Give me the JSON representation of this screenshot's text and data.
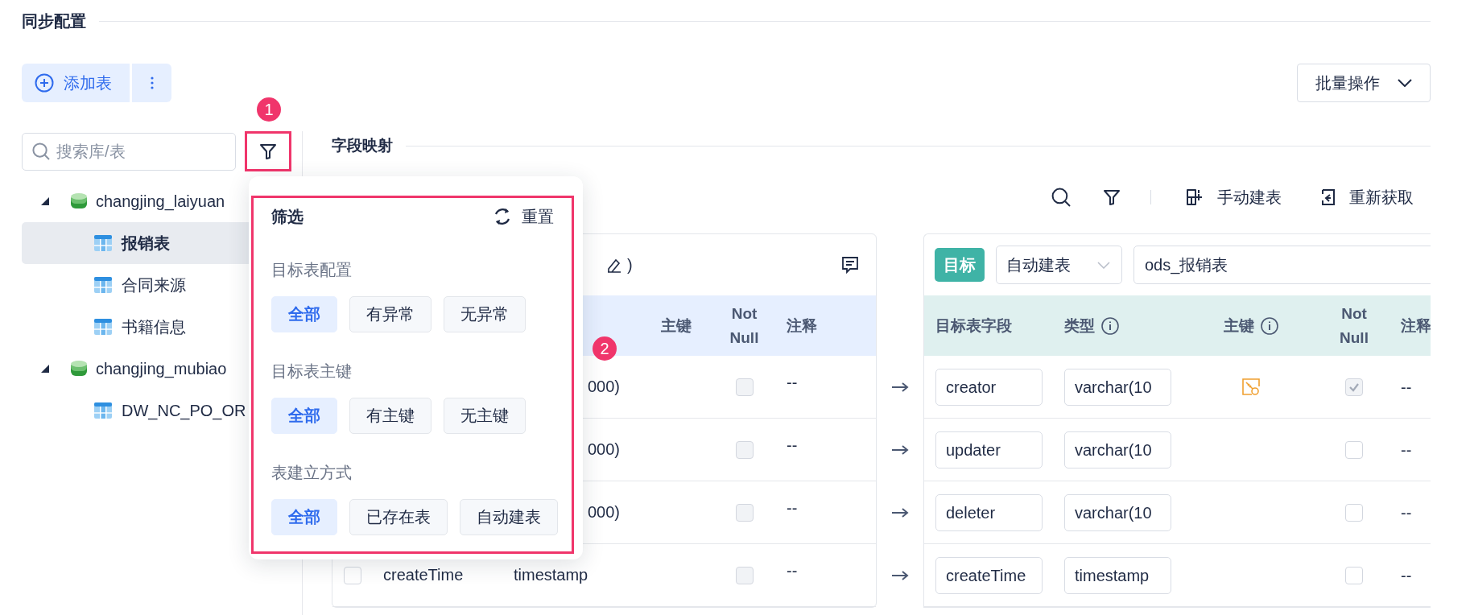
{
  "page_title": "同步配置",
  "add_button": {
    "label": "添加表"
  },
  "batch_button": {
    "label": "批量操作"
  },
  "search": {
    "placeholder": "搜索库/表"
  },
  "tree": [
    {
      "label": "changjing_laiyuan",
      "expanded": true,
      "children": [
        {
          "label": "报销表",
          "selected": true
        },
        {
          "label": "合同来源",
          "selected": false
        },
        {
          "label": "书籍信息",
          "selected": false
        }
      ]
    },
    {
      "label": "changjing_mubiao",
      "expanded": true,
      "children": [
        {
          "label": "DW_NC_PO_OR",
          "selected": false
        }
      ]
    }
  ],
  "annotations": [
    {
      "label": "1"
    },
    {
      "label": "2"
    }
  ],
  "filter_popover": {
    "title": "筛选",
    "reset": "重置",
    "groups": [
      {
        "label": "目标表配置",
        "options": [
          {
            "label": "全部",
            "selected": true
          },
          {
            "label": "有异常",
            "selected": false
          },
          {
            "label": "无异常",
            "selected": false
          }
        ]
      },
      {
        "label": "目标表主键",
        "options": [
          {
            "label": "全部",
            "selected": true
          },
          {
            "label": "有主键",
            "selected": false
          },
          {
            "label": "无主键",
            "selected": false
          }
        ]
      },
      {
        "label": "表建立方式",
        "options": [
          {
            "label": "全部",
            "selected": true
          },
          {
            "label": "已存在表",
            "selected": false
          },
          {
            "label": "自动建表",
            "selected": false
          }
        ]
      }
    ]
  },
  "mapping": {
    "title": "字段映射",
    "toolbar": [
      {
        "kind": "manual",
        "label": "手动建表"
      },
      {
        "kind": "refresh",
        "label": "重新获取"
      }
    ]
  },
  "source": {
    "header_tail": ")",
    "columns": [
      "主键",
      "Not Null",
      "注释"
    ],
    "rows": [
      {
        "kind": "partial",
        "type": "000)",
        "not_null": false,
        "not_null_disabled": true,
        "comment": "--"
      },
      {
        "kind": "partial",
        "type": "000)",
        "not_null": false,
        "not_null_disabled": true,
        "comment": "--"
      },
      {
        "kind": "partial",
        "type": "000)",
        "not_null": false,
        "not_null_disabled": true,
        "comment": "--"
      },
      {
        "kind": "full",
        "checked": false,
        "name": "createTime",
        "type": "timestamp",
        "not_null": false,
        "not_null_disabled": true,
        "comment": "--"
      }
    ]
  },
  "target": {
    "badge": "目标",
    "mode": "自动建表",
    "table_name": "ods_报销表",
    "columns": [
      "目标表字段",
      "类型",
      "主键",
      "Not Null",
      "注释"
    ],
    "rows": [
      {
        "field": "creator",
        "type": "varchar(10",
        "primary_key": true,
        "not_null": true,
        "not_null_disabled": true,
        "comment": "--"
      },
      {
        "field": "updater",
        "type": "varchar(10",
        "primary_key": false,
        "not_null": false,
        "not_null_disabled": false,
        "comment": "--"
      },
      {
        "field": "deleter",
        "type": "varchar(10",
        "primary_key": false,
        "not_null": false,
        "not_null_disabled": false,
        "comment": "--"
      },
      {
        "field": "createTime",
        "type": "timestamp",
        "primary_key": false,
        "not_null": false,
        "not_null_disabled": false,
        "comment": "--"
      }
    ]
  }
}
